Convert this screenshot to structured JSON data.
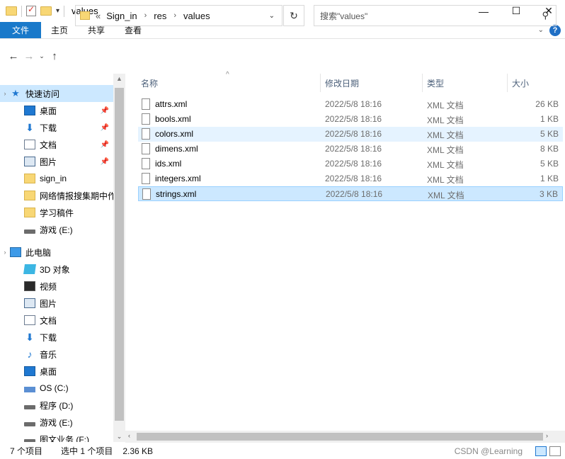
{
  "window": {
    "title": "values",
    "controls": {
      "minimize": "—",
      "maximize": "☐",
      "close": "✕"
    }
  },
  "ribbon": {
    "tabs": [
      "文件",
      "主页",
      "共享",
      "查看"
    ]
  },
  "address": {
    "prefix": "«",
    "crumbs": [
      "Sign_in",
      "res",
      "values"
    ]
  },
  "search": {
    "placeholder": "搜索\"values\""
  },
  "sidebar": {
    "quick_access": {
      "label": "快速访问",
      "items": [
        {
          "label": "桌面",
          "icon": "desktop-icon",
          "pinned": true
        },
        {
          "label": "下载",
          "icon": "download-icon",
          "pinned": true
        },
        {
          "label": "文档",
          "icon": "document-icon",
          "pinned": true
        },
        {
          "label": "图片",
          "icon": "picture-icon",
          "pinned": true
        },
        {
          "label": "sign_in",
          "icon": "folder-icon",
          "pinned": false
        },
        {
          "label": "网络情报搜集期中作",
          "icon": "folder-icon",
          "pinned": false
        },
        {
          "label": "学习稿件",
          "icon": "folder-icon",
          "pinned": false
        },
        {
          "label": "游戏 (E:)",
          "icon": "drive-icon",
          "pinned": false
        }
      ]
    },
    "this_pc": {
      "label": "此电脑",
      "items": [
        {
          "label": "3D 对象",
          "icon": "3d-objects-icon"
        },
        {
          "label": "视频",
          "icon": "video-icon"
        },
        {
          "label": "图片",
          "icon": "picture-icon"
        },
        {
          "label": "文档",
          "icon": "document-icon"
        },
        {
          "label": "下载",
          "icon": "download-icon"
        },
        {
          "label": "音乐",
          "icon": "music-icon"
        },
        {
          "label": "桌面",
          "icon": "desktop-icon"
        },
        {
          "label": "OS (C:)",
          "icon": "os-drive-icon"
        },
        {
          "label": "程序 (D:)",
          "icon": "drive-icon"
        },
        {
          "label": "游戏 (E:)",
          "icon": "drive-icon"
        },
        {
          "label": "图文业务 (F:)",
          "icon": "drive-icon"
        }
      ]
    }
  },
  "columns": [
    "名称",
    "修改日期",
    "类型",
    "大小"
  ],
  "files": [
    {
      "name": "attrs.xml",
      "date": "2022/5/8 18:16",
      "type": "XML 文档",
      "size": "26 KB",
      "state": ""
    },
    {
      "name": "bools.xml",
      "date": "2022/5/8 18:16",
      "type": "XML 文档",
      "size": "1 KB",
      "state": ""
    },
    {
      "name": "colors.xml",
      "date": "2022/5/8 18:16",
      "type": "XML 文档",
      "size": "5 KB",
      "state": "hover"
    },
    {
      "name": "dimens.xml",
      "date": "2022/5/8 18:16",
      "type": "XML 文档",
      "size": "8 KB",
      "state": ""
    },
    {
      "name": "ids.xml",
      "date": "2022/5/8 18:16",
      "type": "XML 文档",
      "size": "5 KB",
      "state": ""
    },
    {
      "name": "integers.xml",
      "date": "2022/5/8 18:16",
      "type": "XML 文档",
      "size": "1 KB",
      "state": ""
    },
    {
      "name": "strings.xml",
      "date": "2022/5/8 18:16",
      "type": "XML 文档",
      "size": "3 KB",
      "state": "selected"
    }
  ],
  "status": {
    "count": "7 个项目",
    "selection": "选中 1 个项目",
    "size": "2.36 KB",
    "watermark": "CSDN @Learning"
  }
}
